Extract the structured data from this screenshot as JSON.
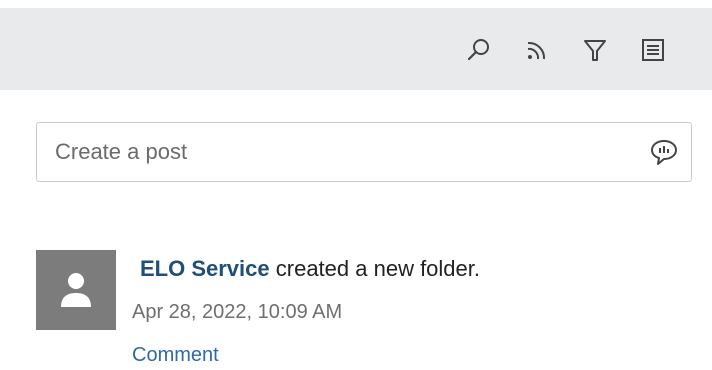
{
  "toolbar": {
    "icons": [
      "search-icon",
      "feed-icon",
      "filter-icon",
      "list-view-icon"
    ]
  },
  "post": {
    "placeholder": "Create a post",
    "icon": "speech-bubble-icon"
  },
  "feed": {
    "entries": [
      {
        "author": "ELO Service",
        "action": " created a new folder.",
        "timestamp": "Apr 28, 2022, 10:09 AM",
        "comment_label": "Comment",
        "avatar_icon": "user-icon"
      }
    ]
  },
  "colors": {
    "toolbar_bg": "#e9eaeb",
    "author_link": "#1f4e79",
    "comment_link": "#2d6ba8",
    "avatar_bg": "#7c7c7c"
  }
}
